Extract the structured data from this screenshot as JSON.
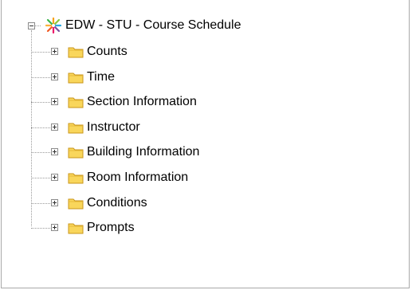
{
  "tree": {
    "root": {
      "label": "EDW - STU - Course Schedule",
      "icon": "universe-icon",
      "expanded": true
    },
    "children": [
      {
        "label": "Counts",
        "icon": "folder-icon",
        "expanded": false
      },
      {
        "label": "Time",
        "icon": "folder-icon",
        "expanded": false
      },
      {
        "label": "Section Information",
        "icon": "folder-icon",
        "expanded": false
      },
      {
        "label": "Instructor",
        "icon": "folder-icon",
        "expanded": false
      },
      {
        "label": "Building Information",
        "icon": "folder-icon",
        "expanded": false
      },
      {
        "label": "Room Information",
        "icon": "folder-icon",
        "expanded": false
      },
      {
        "label": "Conditions",
        "icon": "folder-icon",
        "expanded": false
      },
      {
        "label": "Prompts",
        "icon": "folder-icon",
        "expanded": false
      }
    ]
  },
  "colors": {
    "folder_fill": "#f9d65b",
    "folder_tab": "#e8b93a",
    "tree_line": "#9a9a9a",
    "border": "#a9a9a9"
  }
}
